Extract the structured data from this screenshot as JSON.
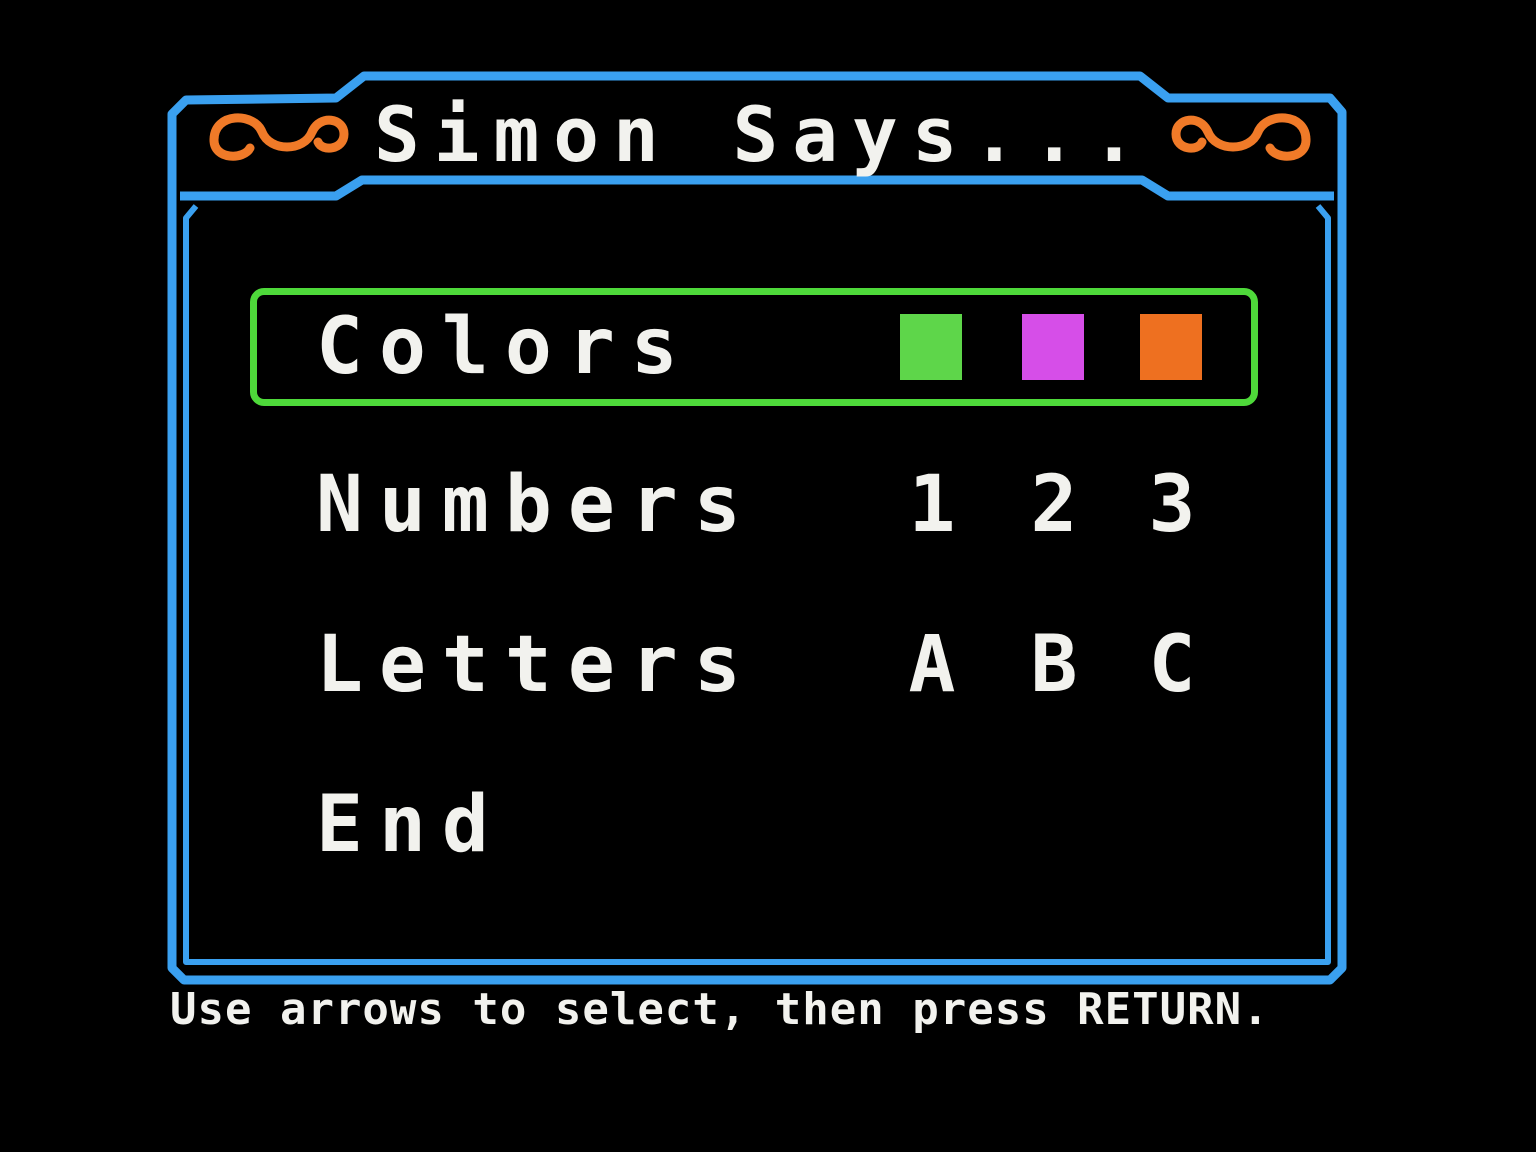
{
  "title": "Simon Says...",
  "colors": {
    "frame": "#3aa0f0",
    "accent_ornament": "#f07a28",
    "selection": "#4ed93a",
    "text": "#f2f2ee",
    "background": "#000000"
  },
  "menu": {
    "items": [
      {
        "label": "Colors",
        "selected": true,
        "swatches": [
          "#5ed64a",
          "#d64ee8",
          "#ee7020"
        ]
      },
      {
        "label": "Numbers",
        "selected": false,
        "glyphs": [
          "1",
          "2",
          "3"
        ]
      },
      {
        "label": "Letters",
        "selected": false,
        "glyphs": [
          "A",
          "B",
          "C"
        ]
      },
      {
        "label": "End",
        "selected": false
      }
    ]
  },
  "footer": {
    "instructions": "Use arrows to select, then press RETURN."
  }
}
